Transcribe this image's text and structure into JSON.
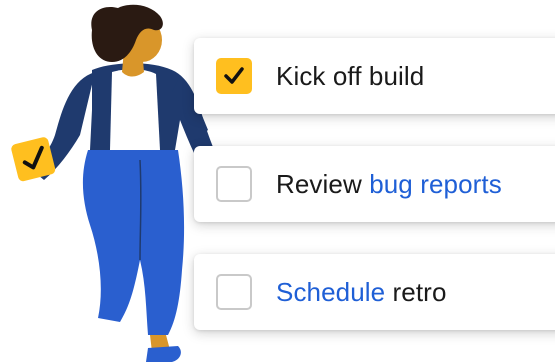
{
  "colors": {
    "check_accent": "#ffbf1f",
    "link": "#1f5fd6",
    "text": "#1a1a1a",
    "jacket": "#1f3a6e",
    "pants": "#2a5fcf",
    "skin": "#d9962a",
    "hair": "#2a1a12"
  },
  "tasks": [
    {
      "checked": true,
      "text": "Kick off build",
      "link_text": ""
    },
    {
      "checked": false,
      "text": "Review ",
      "link_text": "bug reports"
    },
    {
      "checked": false,
      "link_text": "Schedule",
      "text": " retro"
    }
  ],
  "icons": {
    "checkmark": "checkmark-icon",
    "person": "person-illustration"
  }
}
